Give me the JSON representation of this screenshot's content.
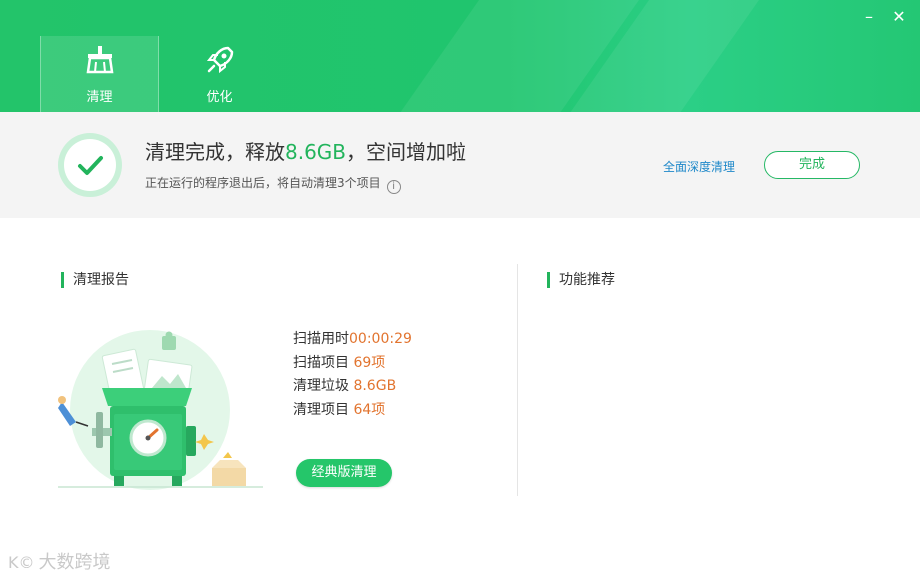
{
  "window": {
    "minimize_glyph": "–",
    "close_glyph": "✕"
  },
  "tabs": [
    {
      "label": "清理",
      "icon": "broom-icon",
      "active": true
    },
    {
      "label": "优化",
      "icon": "rocket-icon",
      "active": false
    }
  ],
  "result": {
    "title_prefix": "清理完成，释放",
    "freed": "8.6GB",
    "title_suffix": "，空间增加啦",
    "subtitle": "正在运行的程序退出后，将自动清理3个项目",
    "info_icon_glyph": "i",
    "deep_clean_link": "全面深度清理",
    "done_button": "完成"
  },
  "report": {
    "title": "清理报告",
    "stats": [
      {
        "label": "扫描用时",
        "value": "00:00:29"
      },
      {
        "label": "扫描项目 ",
        "value": "69项"
      },
      {
        "label": "清理垃圾 ",
        "value": "8.6GB"
      },
      {
        "label": "清理项目 ",
        "value": "64项"
      }
    ],
    "classic_button": "经典版清理"
  },
  "recommend": {
    "title": "功能推荐"
  },
  "watermark": {
    "logo": "K©",
    "text": "大数跨境"
  },
  "colors": {
    "brand_green": "#22c46a",
    "highlight_orange": "#e2742f",
    "link_blue": "#1e88c9"
  }
}
